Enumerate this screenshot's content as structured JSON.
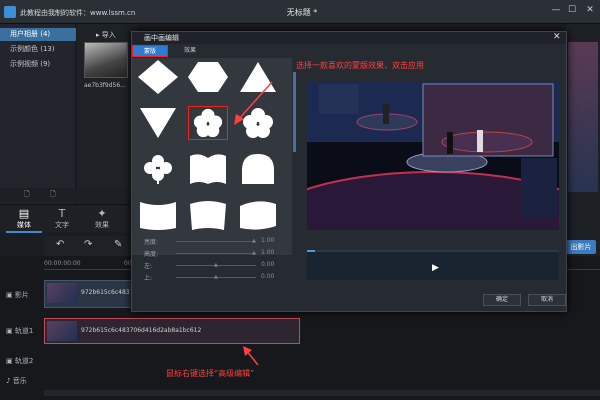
{
  "titlebar": {
    "watermark": "此教程由我制的软件：www.lssm.cn",
    "title": "无标题 *",
    "minimize": "—",
    "maximize": "☐",
    "close": "✕"
  },
  "library": {
    "items": [
      {
        "label": "用户相册 (4)"
      },
      {
        "label": "示例颜色 (13)"
      },
      {
        "label": "示例视频 (9)"
      }
    ],
    "import_label": "导入",
    "thumb_label": "ae7b3f9d56..."
  },
  "tabs": [
    {
      "label": "媒体",
      "icon": "film-icon",
      "glyph": "▤"
    },
    {
      "label": "文字",
      "icon": "text-icon",
      "glyph": "T"
    },
    {
      "label": "效果",
      "icon": "magic-wand-icon",
      "glyph": "✦"
    }
  ],
  "toolbar": {
    "undo": "↶",
    "redo": "↷",
    "edit": "✎"
  },
  "export_label": "出影片",
  "timeline": {
    "ticks": [
      "00:00:00:00",
      "00:00:30:00"
    ],
    "tracks": [
      {
        "label": "影片"
      },
      {
        "label": "轨道1"
      },
      {
        "label": "轨道2"
      },
      {
        "label": "音乐"
      }
    ],
    "video_clip_name": "972b615c6c483706d416d2ab8a1bc612",
    "track1_clip_name": "972b615c6c483706d416d2ab8a1bc612",
    "annotation": "鼠标右键选择“高级编辑”"
  },
  "modal": {
    "title": "画中画编辑",
    "close": "✕",
    "tabs": [
      {
        "label": "蒙版"
      },
      {
        "label": "效果"
      }
    ],
    "annotation": "选择一款喜欢的蒙版效果，双击应用",
    "sliders": [
      {
        "label": "亮度:",
        "value": "1.00"
      },
      {
        "label": "高度:",
        "value": "1.00"
      },
      {
        "label": "左:",
        "value": "0.00"
      },
      {
        "label": "上:",
        "value": "0.00"
      }
    ],
    "play": "▶",
    "ok": "确定",
    "cancel": "取消"
  },
  "colors": {
    "accent": "#2f7bd4",
    "annotation": "#ff4040",
    "highlight": "#e22222"
  }
}
